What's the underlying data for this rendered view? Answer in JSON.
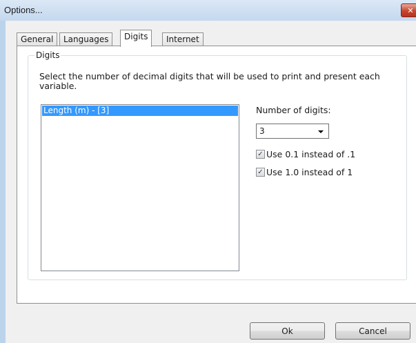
{
  "window": {
    "title": "Options...",
    "close_glyph": "✕"
  },
  "tabs": [
    {
      "label": "General",
      "active": false
    },
    {
      "label": "Languages",
      "active": false
    },
    {
      "label": "Digits",
      "active": true
    },
    {
      "label": "Internet",
      "active": false
    }
  ],
  "digits": {
    "group_title": "Digits",
    "description": "Select the number of decimal digits that will be used to print and present each variable.",
    "variables": [
      {
        "label": "Length (m) - [3]",
        "selected": true
      }
    ],
    "number_of_digits_label": "Number of digits:",
    "number_of_digits_value": "3",
    "options": [
      {
        "label": "Use 0.1 instead of .1",
        "checked": true
      },
      {
        "label": "Use 1.0 instead of 1",
        "checked": true
      }
    ]
  },
  "buttons": {
    "ok": "Ok",
    "cancel": "Cancel"
  },
  "icons": {
    "checkmark": "✓",
    "dropdown_arrow": "chevron-down-icon"
  },
  "colors": {
    "selection": "#3399ff",
    "window_frame": "#bcd3ec",
    "close_button": "#c7462f"
  }
}
